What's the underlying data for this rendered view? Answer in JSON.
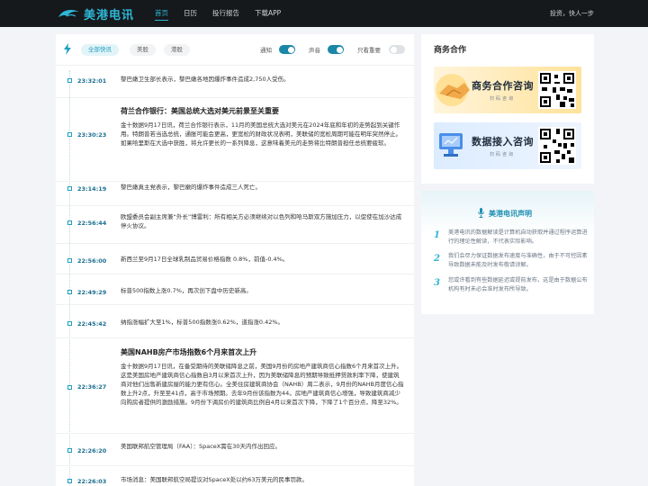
{
  "header": {
    "logo_text": "美港电讯",
    "nav": [
      {
        "label": "首页",
        "active": true
      },
      {
        "label": "日历",
        "active": false
      },
      {
        "label": "投行报告",
        "active": false
      },
      {
        "label": "下载APP",
        "active": false
      }
    ],
    "login_text": "投资，快人一步"
  },
  "filters": {
    "chips": [
      {
        "label": "全部快讯",
        "active": true
      },
      {
        "label": "美股",
        "active": false
      },
      {
        "label": "港股",
        "active": false
      }
    ],
    "toggles": [
      {
        "label": "通知",
        "on": true
      },
      {
        "label": "声音",
        "on": true
      },
      {
        "label": "只看重要",
        "on": false
      }
    ]
  },
  "feed": [
    {
      "time": "23:32:01",
      "title": "",
      "text": "黎巴嫩卫生部长表示，黎巴嫩各地因爆炸事件造成2,750人受伤。"
    },
    {
      "time": "23:30:23",
      "title": "荷兰合作银行：美国总统大选对美元前景至关重要",
      "text": "金十数据9月17日讯，荷兰合作银行表示，11月的美国总统大选对美元在2024年底和年初的走势起到关键作用。特朗普若当选总统，通胀可能会更高，更宽松的财政状况表明，美联储的宽松周期可能在明年突然停止。如果哈里斯在大选中获胜，将允许更长的一系列降息，这意味着美元的走势将比特朗普担任总统要疲软。"
    },
    {
      "time": "23:14:19",
      "title": "",
      "text": "黎巴嫩真主党表示，黎巴嫩的爆炸事件造成三人死亡。"
    },
    {
      "time": "22:56:44",
      "title": "",
      "text": "欧盟委员会副主席兼“外长”博雷利：所有相关方必须继续对以色列和哈马斯双方施加压力，以促使在加沙达成停火协议。"
    },
    {
      "time": "22:56:00",
      "title": "",
      "text": "新西兰至9月17日全球乳制品贸易价格指数 0.8%，前值-0.4%。"
    },
    {
      "time": "22:49:29",
      "title": "",
      "text": "标普500指数上涨0.7%，再次创下盘中历史新高。"
    },
    {
      "time": "22:45:42",
      "title": "",
      "text": "纳指涨幅扩大至1%，标普500指数涨0.62%，道指涨0.42%。"
    },
    {
      "time": "22:36:27",
      "title": "美国NAHB房产市场指数6个月来首次上升",
      "text": "金十数据9月17日讯，在备受期待的美联储降息之前，美国9月份的房地产建筑商信心指数6个月来首次上升。这是美国房地产建筑商信心指数自3月以来首次上升，因为美联储降息的预期导致抵押贷款利率下降，使建筑商对他们出售新建房屋的能力更有信心。全美住房建筑商协会（NAHB）周二表示，9月份的NAHB月度信心指数上升2点，升至至41点，高于市场预期。去年9月份该指数为44。房地产建筑商信心增强，导致建筑商减少向购房者提供的激励措施。9月份下调房价的建筑商比例自4月以来首次下降，下降了1个百分点，降至32%。"
    },
    {
      "time": "22:26:20",
      "title": "",
      "text": "美国联邦航空管理局（FAA）：SpaceX需在30天内作出回应。"
    },
    {
      "time": "22:26:03",
      "title": "",
      "text": "市场消息：美国联邦航空局提议对SpaceX处以约63万美元的民事罚款。"
    }
  ],
  "sidebar": {
    "business_title": "商务合作",
    "banners": [
      {
        "text": "商务合作咨询",
        "sub": "扫码咨询"
      },
      {
        "text": "数据接入咨询",
        "sub": "扫码咨询"
      }
    ],
    "statement_title": "美港电讯声明",
    "statements": [
      {
        "num": "1",
        "text": "美港电讯的数据解读是计算机自动获取并通过程序运算进行的理论性解读，不代表实际影响。"
      },
      {
        "num": "2",
        "text": "我们会尽力保证数据发布速度与准确性，由于不可控因素导致数据未能及时发布敬请谅解。"
      },
      {
        "num": "3",
        "text": "您或许看到有些数据延迟或提前发布，这是由于数据公布机构有时未必会准时发布所导致。"
      }
    ]
  },
  "colors": {
    "accent": "#2fb6d6",
    "topbar": "#15191c",
    "time": "#1c6f8f"
  }
}
